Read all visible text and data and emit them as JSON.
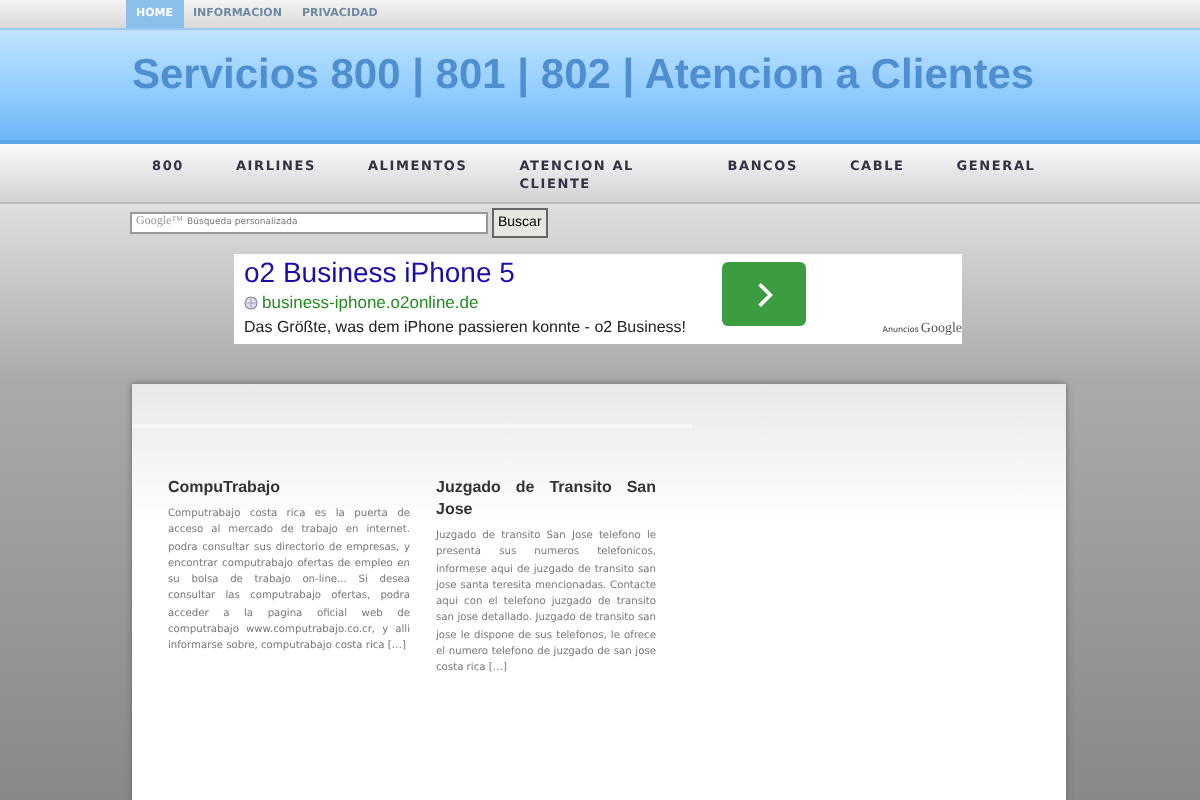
{
  "top_tabs": [
    {
      "label": "HOME",
      "selected": true
    },
    {
      "label": "INFORMACION",
      "selected": false
    },
    {
      "label": "PRIVACIDAD",
      "selected": false
    }
  ],
  "site_title": "Servicios 800 | 801 | 802 | Atencion a Clientes",
  "nav": [
    "800",
    "AIRLINES",
    "ALIMENTOS",
    "ATENCION AL CLIENTE",
    "BANCOS",
    "CABLE",
    "GENERAL"
  ],
  "search": {
    "brand": "Google™",
    "placeholder": "Búsqueda personalizada",
    "button": "Buscar"
  },
  "ad": {
    "title": "o2 Business iPhone 5",
    "url": "business-iphone.o2online.de",
    "text": "Das Größte, was dem iPhone passieren konnte - o2 Business!",
    "label": "Anuncios",
    "brand": "Google"
  },
  "posts": [
    {
      "title": "CompuTrabajo",
      "excerpt": "Computrabajo costa rica es la puerta de acceso al mercado de trabajo en internet. podra consultar sus directorio de empresas, y encontrar computrabajo ofertas de empleo en su bolsa de trabajo on-line... Si desea consultar las computrabajo ofertas, podra acceder a la pagina oficial web de computrabajo www.computrabajo.co.cr, y alli informarse sobre, computrabajo costa rica […]"
    },
    {
      "title": "Juzgado de Transito San Jose",
      "excerpt": "Juzgado de transito San Jose telefono le presenta sus numeros telefonicos, informese aqui de juzgado de transito san jose santa teresita mencionadas. Contacte aqui con el telefono juzgado de transito san jose detallado. Juzgado de transito san jose le dispone de sus telefonos, le ofrece el numero telefono de juzgado de san jose costa rica […]"
    }
  ]
}
